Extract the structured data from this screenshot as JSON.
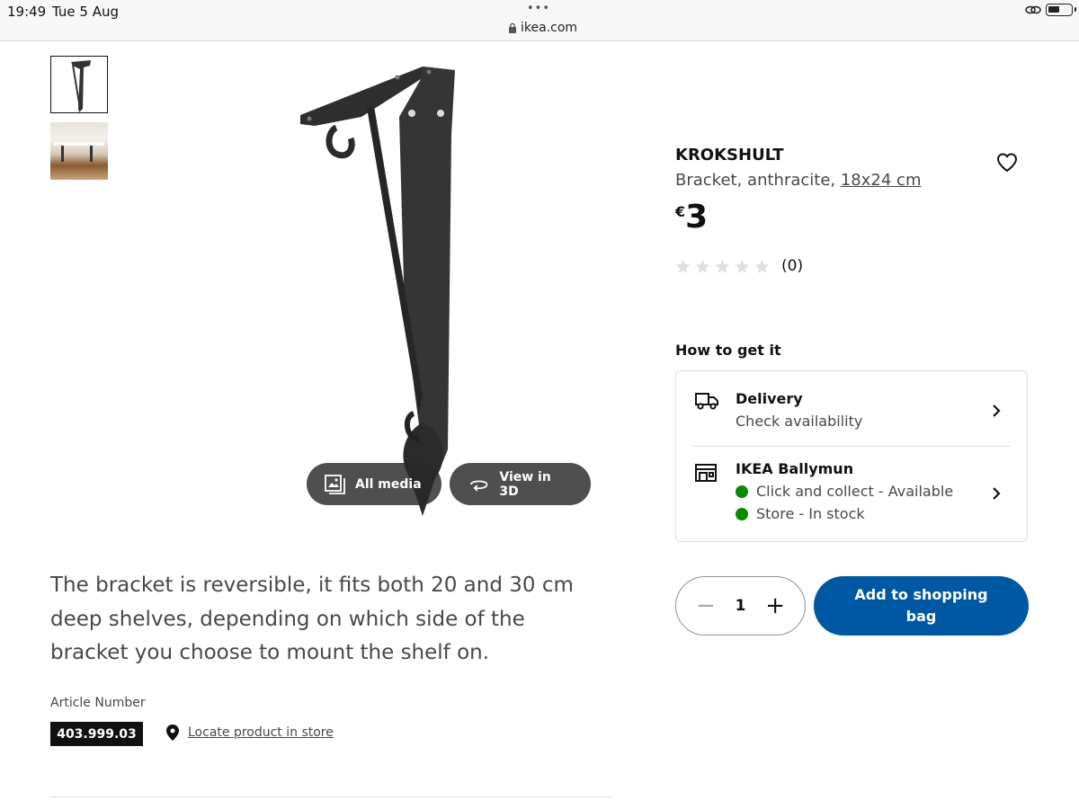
{
  "status_bar": {
    "time": "19:49",
    "date": "Tue 5 Aug",
    "url": "ikea.com",
    "dots": "•••"
  },
  "gallery": {
    "thumbnails": [
      {
        "alt": "bracket-front"
      },
      {
        "alt": "bracket-in-use"
      }
    ],
    "all_media_label": "All media",
    "view_3d_label": "View in 3D"
  },
  "description": "The bracket is reversible, it fits both 20 and 30 cm deep shelves, depending on which side of the bracket you choose to mount the shelf on.",
  "article": {
    "label": "Article Number",
    "number": "403.999.03",
    "locate_label": "Locate product in store"
  },
  "product": {
    "name": "KROKSHULT",
    "type": "Bracket, anthracite,",
    "size": "18x24 cm",
    "currency": "€",
    "price": "3",
    "rating_count": "(0)",
    "stars": 0
  },
  "how_to_get": {
    "title": "How to get it",
    "delivery": {
      "title": "Delivery",
      "subtitle": "Check availability"
    },
    "store": {
      "title": "IKEA Ballymun",
      "click_collect": "Click and collect - Available",
      "store_stock": "Store - In stock"
    }
  },
  "purchase": {
    "quantity": "1",
    "add_label": "Add to shopping bag",
    "minus": "−",
    "plus": "+"
  },
  "colors": {
    "accent": "#0058a3",
    "available": "#0a8a00",
    "text": "#111111",
    "muted": "#484848"
  }
}
